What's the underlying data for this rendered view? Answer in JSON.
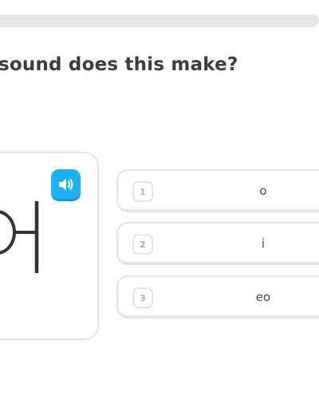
{
  "question": "sound does this make?",
  "character": "어",
  "speaker_icon": "speaker-icon",
  "accent_color": "#1cb0f6",
  "options": [
    {
      "number": "1",
      "label": "o"
    },
    {
      "number": "2",
      "label": "i"
    },
    {
      "number": "3",
      "label": "eo"
    }
  ]
}
